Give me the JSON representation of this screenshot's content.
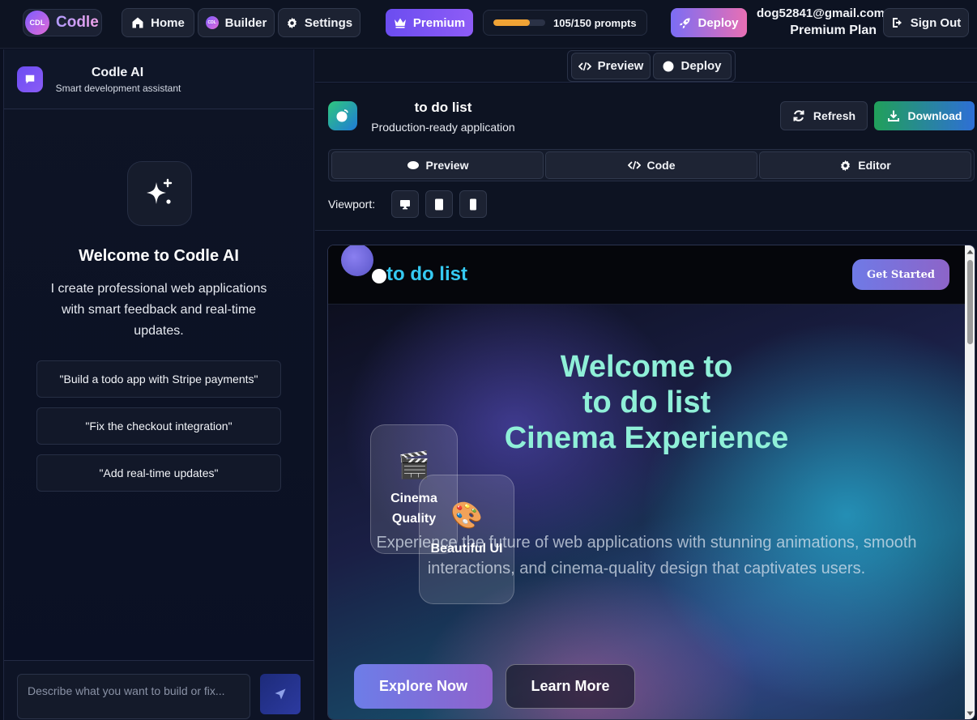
{
  "app": {
    "logo_badge": "CDL",
    "logo_text": "Codle"
  },
  "nav": {
    "home": "Home",
    "builder": "Builder",
    "builder_badge": "CDL",
    "settings": "Settings",
    "premium": "Premium",
    "usage_text": "105/150  prompts",
    "usage_used": 105,
    "usage_limit": 150,
    "deploy": "Deploy",
    "user_email": "dog52841@gmail.com",
    "user_plan": "Premium Plan",
    "sign_out": "Sign Out"
  },
  "assistant": {
    "title": "Codle AI",
    "subtitle": "Smart development assistant",
    "welcome_title": "Welcome to Codle AI",
    "welcome_desc": "I create professional web applications with smart feedback and real-time updates.",
    "suggestions": [
      "\"Build a todo app with Stripe payments\"",
      "\"Fix the checkout integration\"",
      "\"Add real-time updates\""
    ],
    "input_placeholder": "Describe what you want to build or fix..."
  },
  "workspace": {
    "mode_preview": "Preview",
    "mode_deploy": "Deploy",
    "project_title": "to do list",
    "project_subtitle": "Production-ready application",
    "refresh": "Refresh",
    "download": "Download",
    "tabs": [
      "Preview",
      "Code",
      "Editor"
    ],
    "viewport_label": "Viewport:"
  },
  "preview_site": {
    "brand": "to do list",
    "get_started": "Get Started",
    "hero_line1": "Welcome to",
    "hero_line2": "to do list",
    "hero_line3": "Cinema Experience",
    "card1_emoji": "🎬",
    "card1_label": "Cinema Quality",
    "card2_emoji": "🎨",
    "card2_label": "Beautiful UI",
    "description": "Experience the future of web applications with stunning animations, smooth interactions, and cinema-quality design that captivates users.",
    "explore": "Explore Now",
    "learn_more": "Learn More"
  },
  "colors": {
    "accent_purple": "#6b4df0",
    "usage_bar": "#f0a335",
    "download_green": "#21a05a",
    "brand_cyan": "#35c9f2",
    "hero_title": "#8ff0d8"
  },
  "icons": {
    "home": "home-icon",
    "settings": "gear-icon",
    "premium": "crown-icon",
    "deploy": "rocket-icon",
    "sign_out": "sign-out-icon",
    "chat": "chat-bubble-icon",
    "sparkle": "sparkles-icon",
    "send": "send-icon",
    "code": "code-icon",
    "circle": "circle-icon",
    "refresh": "refresh-icon",
    "download": "download-icon",
    "eye": "eye-icon",
    "desktop": "desktop-icon",
    "tablet": "tablet-icon",
    "mobile": "mobile-icon"
  }
}
